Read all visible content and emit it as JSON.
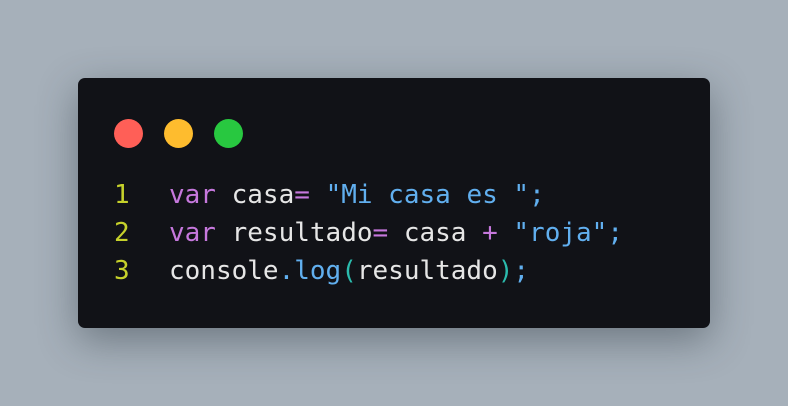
{
  "colors": {
    "background": "#a6b0ba",
    "window_bg": "#111217",
    "close": "#ff5f57",
    "minimize": "#febc2e",
    "maximize": "#28c840",
    "line_number": "#c6d12b",
    "keyword": "#c678dd",
    "plain": "#e6e6e6",
    "string": "#61afef",
    "method": "#61afef",
    "paren": "#2bbbad"
  },
  "window_controls": [
    "close",
    "minimize",
    "maximize"
  ],
  "code": {
    "lines": [
      {
        "number": "1",
        "tokens": [
          {
            "text": "var",
            "kind": "keyword"
          },
          {
            "text": " casa",
            "kind": "plain"
          },
          {
            "text": "=",
            "kind": "keyword"
          },
          {
            "text": " ",
            "kind": "plain"
          },
          {
            "text": "\"Mi casa es \"",
            "kind": "string"
          },
          {
            "text": ";",
            "kind": "string"
          }
        ]
      },
      {
        "number": "2",
        "tokens": [
          {
            "text": "var",
            "kind": "keyword"
          },
          {
            "text": " resultado",
            "kind": "plain"
          },
          {
            "text": "=",
            "kind": "keyword"
          },
          {
            "text": " casa ",
            "kind": "plain"
          },
          {
            "text": "+",
            "kind": "keyword"
          },
          {
            "text": " ",
            "kind": "plain"
          },
          {
            "text": "\"roja\"",
            "kind": "string"
          },
          {
            "text": ";",
            "kind": "string"
          }
        ]
      },
      {
        "number": "3",
        "tokens": [
          {
            "text": "console",
            "kind": "plain"
          },
          {
            "text": ".",
            "kind": "method"
          },
          {
            "text": "log",
            "kind": "method"
          },
          {
            "text": "(",
            "kind": "paren"
          },
          {
            "text": "resultado",
            "kind": "plain"
          },
          {
            "text": ")",
            "kind": "paren"
          },
          {
            "text": ";",
            "kind": "string"
          }
        ]
      }
    ]
  }
}
